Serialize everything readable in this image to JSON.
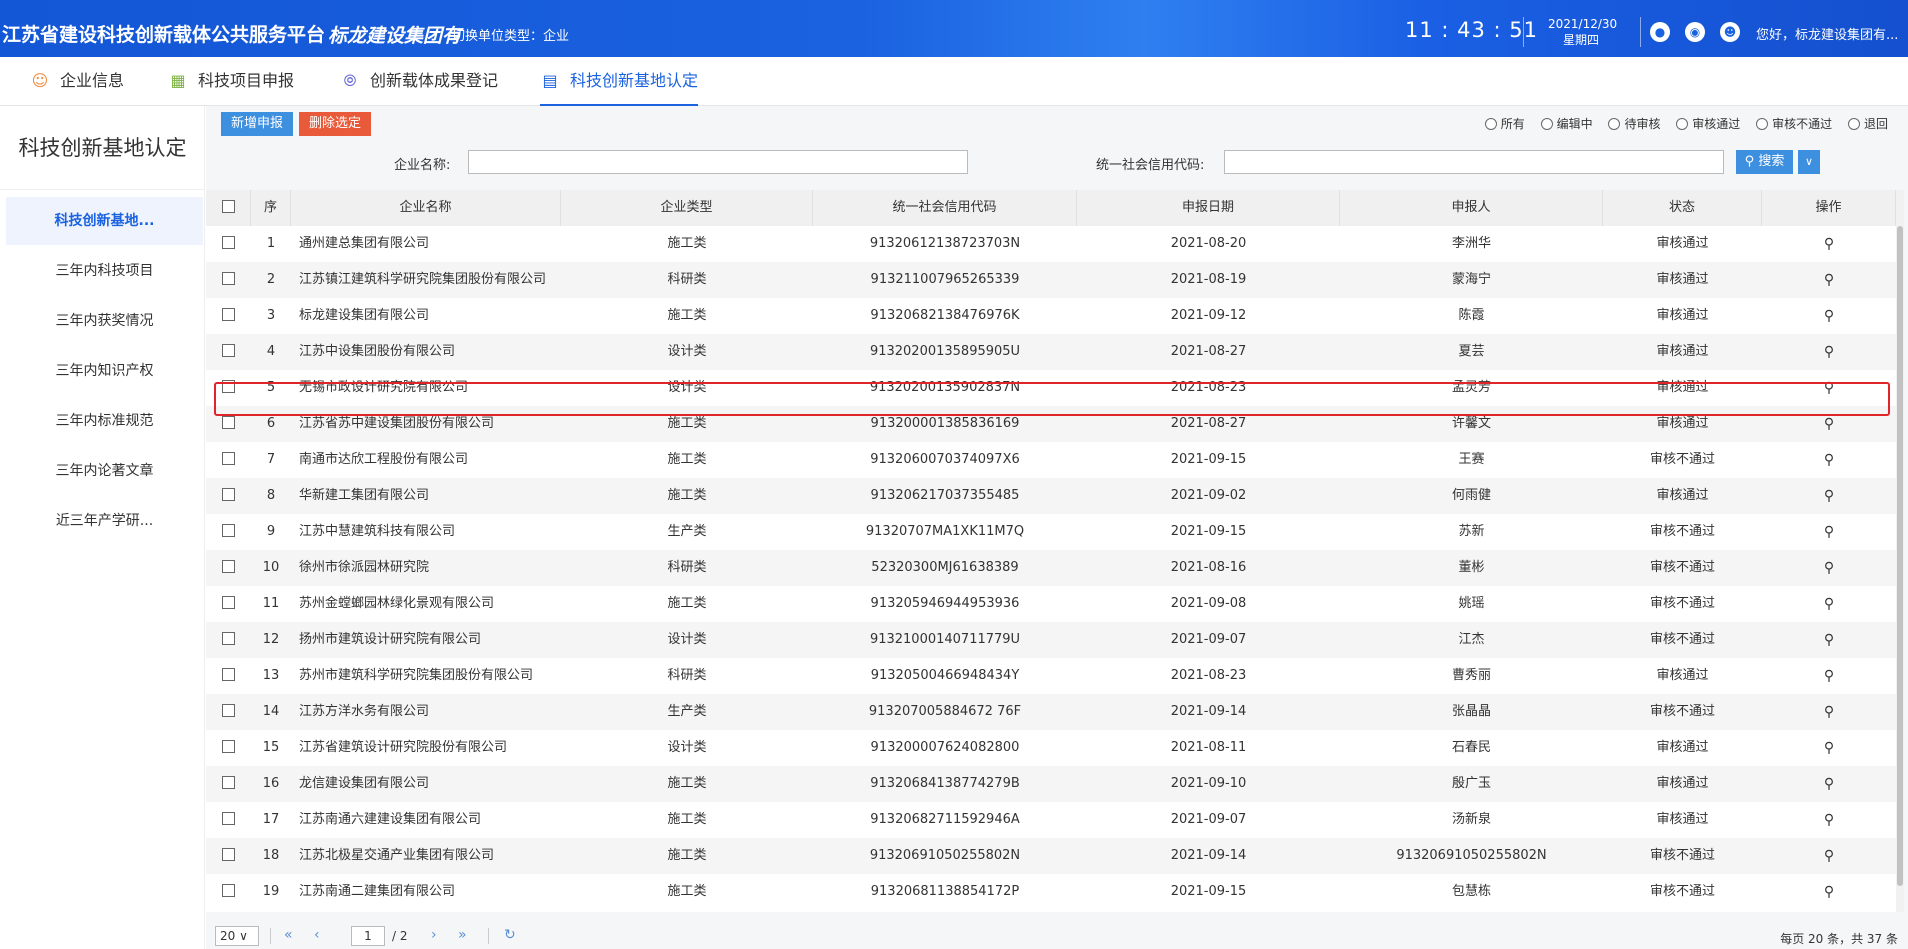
{
  "header": {
    "title": "江苏省建设科技创新载体公共服务平台",
    "company": "标龙建设集团有",
    "switch_label": "切换单位类型：企业",
    "time": "11 : 43 : 51",
    "date": "2021/12/30",
    "weekday": "星期四",
    "greeting": "您好，标龙建设集团有...",
    "icons": [
      "bell-icon",
      "chat-icon",
      "user-icon"
    ]
  },
  "nav": {
    "items": [
      {
        "label": "企业信息",
        "icon": "user-icon"
      },
      {
        "label": "科技项目申报",
        "icon": "building-icon"
      },
      {
        "label": "创新载体成果登记",
        "icon": "compass-icon"
      },
      {
        "label": "科技创新基地认定",
        "icon": "document-search-icon"
      }
    ],
    "active": 3
  },
  "sidebar": {
    "title": "科技创新基地认定",
    "items": [
      {
        "label": "科技创新基地..."
      },
      {
        "label": "三年内科技项目"
      },
      {
        "label": "三年内获奖情况"
      },
      {
        "label": "三年内知识产权"
      },
      {
        "label": "三年内标准规范"
      },
      {
        "label": "三年内论著文章"
      },
      {
        "label": "近三年产学研..."
      }
    ],
    "active": 0
  },
  "toolbar": {
    "add_label": "新增申报",
    "delete_label": "删除选定",
    "filters": [
      "所有",
      "编辑中",
      "待审核",
      "审核通过",
      "审核不通过",
      "退回"
    ]
  },
  "search": {
    "company_label": "企业名称:",
    "company_value": "",
    "code_label": "统一社会信用代码:",
    "code_value": "",
    "button_label": "搜索"
  },
  "table": {
    "headers": {
      "index": "序",
      "name": "企业名称",
      "type": "企业类型",
      "code": "统一社会信用代码",
      "date": "申报日期",
      "applicant": "申报人",
      "status": "状态",
      "op": "操作"
    },
    "rows": [
      {
        "index": "1",
        "name": "通州建总集团有限公司",
        "type": "施工类",
        "code": "91320612138723703N",
        "date": "2021-08-20",
        "applicant": "李洲华",
        "status": "审核通过"
      },
      {
        "index": "2",
        "name": "江苏镇江建筑科学研究院集团股份有限公司",
        "type": "科研类",
        "code": "913211007965265339",
        "date": "2021-08-19",
        "applicant": "蒙海宁",
        "status": "审核通过"
      },
      {
        "index": "3",
        "name": "标龙建设集团有限公司",
        "type": "施工类",
        "code": "91320682138476976K",
        "date": "2021-09-12",
        "applicant": "陈霞",
        "status": "审核通过"
      },
      {
        "index": "4",
        "name": "江苏中设集团股份有限公司",
        "type": "设计类",
        "code": "91320200135895905U",
        "date": "2021-08-27",
        "applicant": "夏芸",
        "status": "审核通过"
      },
      {
        "index": "5",
        "name": "无锡市政设计研究院有限公司",
        "type": "设计类",
        "code": "91320200135902837N",
        "date": "2021-08-23",
        "applicant": "孟灵芳",
        "status": "审核通过"
      },
      {
        "index": "6",
        "name": "江苏省苏中建设集团股份有限公司",
        "type": "施工类",
        "code": "913200001385836169",
        "date": "2021-08-27",
        "applicant": "许馨文",
        "status": "审核通过"
      },
      {
        "index": "7",
        "name": "南通市达欣工程股份有限公司",
        "type": "施工类",
        "code": "9132060070374097X6",
        "date": "2021-09-15",
        "applicant": "王赛",
        "status": "审核不通过"
      },
      {
        "index": "8",
        "name": "华新建工集团有限公司",
        "type": "施工类",
        "code": "913206217037355485",
        "date": "2021-09-02",
        "applicant": "何雨健",
        "status": "审核通过"
      },
      {
        "index": "9",
        "name": "江苏中慧建筑科技有限公司",
        "type": "生产类",
        "code": "91320707MA1XK11M7Q",
        "date": "2021-09-15",
        "applicant": "苏新",
        "status": "审核不通过"
      },
      {
        "index": "10",
        "name": "徐州市徐派园林研究院",
        "type": "科研类",
        "code": "52320300MJ61638389",
        "date": "2021-08-16",
        "applicant": "董彬",
        "status": "审核不通过"
      },
      {
        "index": "11",
        "name": "苏州金螳螂园林绿化景观有限公司",
        "type": "施工类",
        "code": "913205946944953936",
        "date": "2021-09-08",
        "applicant": "姚瑶",
        "status": "审核不通过"
      },
      {
        "index": "12",
        "name": "扬州市建筑设计研究院有限公司",
        "type": "设计类",
        "code": "91321000140711779U",
        "date": "2021-09-07",
        "applicant": "江杰",
        "status": "审核不通过"
      },
      {
        "index": "13",
        "name": "苏州市建筑科学研究院集团股份有限公司",
        "type": "科研类",
        "code": "91320500466948434Y",
        "date": "2021-08-23",
        "applicant": "曹秀丽",
        "status": "审核通过"
      },
      {
        "index": "14",
        "name": "江苏方洋水务有限公司",
        "type": "生产类",
        "code": "913207005884672 76F",
        "date": "2021-09-14",
        "applicant": "张晶晶",
        "status": "审核不通过"
      },
      {
        "index": "15",
        "name": "江苏省建筑设计研究院股份有限公司",
        "type": "设计类",
        "code": "913200007624082800",
        "date": "2021-08-11",
        "applicant": "石春民",
        "status": "审核通过"
      },
      {
        "index": "16",
        "name": "龙信建设集团有限公司",
        "type": "施工类",
        "code": "91320684138774279B",
        "date": "2021-09-10",
        "applicant": "殷广玉",
        "status": "审核通过"
      },
      {
        "index": "17",
        "name": "江苏南通六建建设集团有限公司",
        "type": "施工类",
        "code": "91320682711592946A",
        "date": "2021-09-07",
        "applicant": "汤新泉",
        "status": "审核通过"
      },
      {
        "index": "18",
        "name": "江苏北极星交通产业集团有限公司",
        "type": "施工类",
        "code": "91320691050255802N",
        "date": "2021-09-14",
        "applicant": "91320691050255802N",
        "status": "审核不通过"
      },
      {
        "index": "19",
        "name": "江苏南通二建集团有限公司",
        "type": "施工类",
        "code": "91320681138854172P",
        "date": "2021-09-15",
        "applicant": "包慧栋",
        "status": "审核不通过"
      }
    ]
  },
  "pager": {
    "page_size": "20",
    "current_page": "1",
    "total_pages": "/ 2",
    "info": "每页 20 条，共 37 条"
  },
  "colors": {
    "header_blue": "#1a62e0",
    "add_button": "#3d8fe0",
    "delete_button": "#e95a3a",
    "highlight": "#e0242a"
  }
}
